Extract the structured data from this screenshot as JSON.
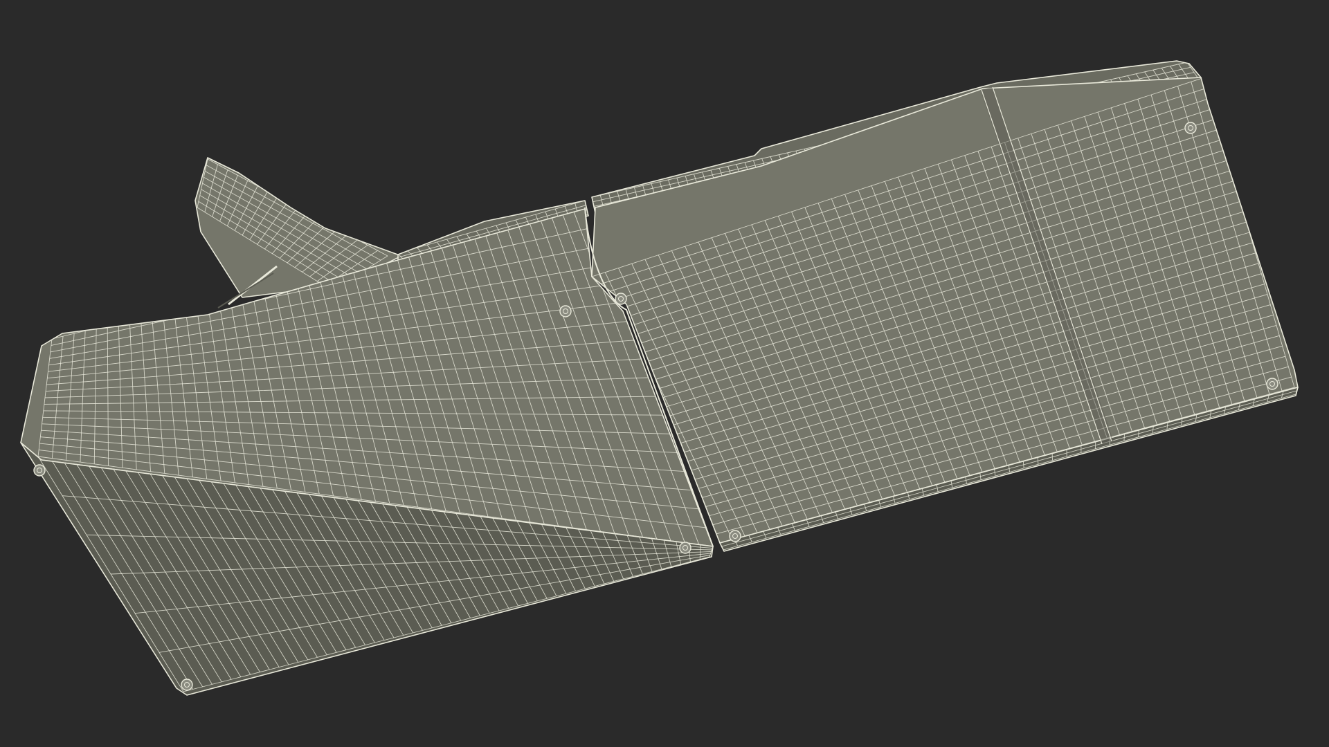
{
  "scene": {
    "subject": "wireframe-sectional-sofa-bottom-view",
    "colors": {
      "background": "#2a2a2a",
      "surface": "#75766a",
      "surface_side": "#6a6b60",
      "surface_dark": "#5b5c52",
      "wire": "#e9e9da",
      "foot": "#8a8b80"
    }
  }
}
